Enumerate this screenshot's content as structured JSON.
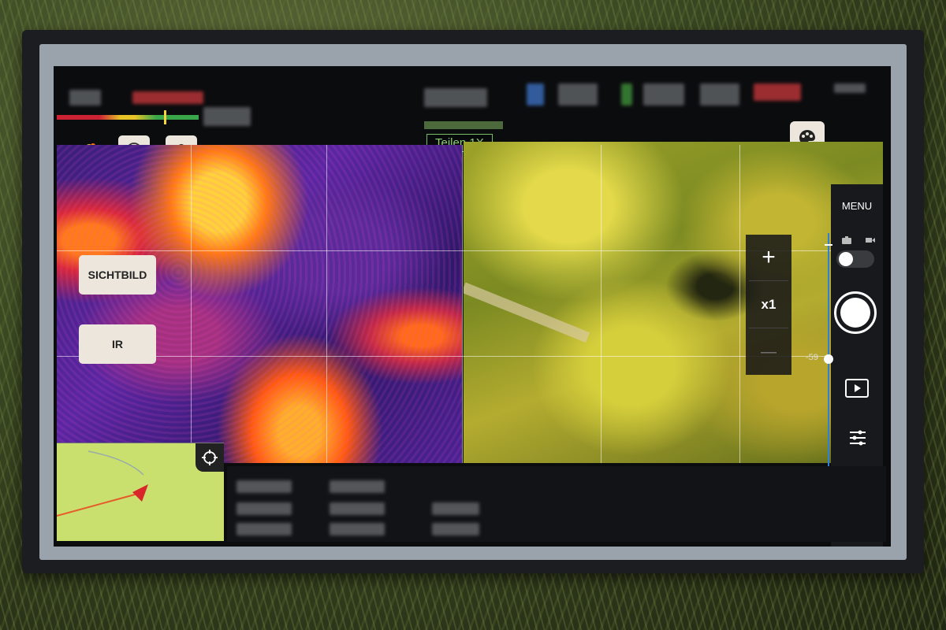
{
  "feeds": {
    "ir_button_label": "SICHTBILD",
    "ir_mode_label": "IR",
    "share_label": "Teilen 1X"
  },
  "zoom": {
    "plus_label": "+",
    "level_label": "x1",
    "minus_label": "—"
  },
  "camera_panel": {
    "menu_label": "MENU",
    "ev_value": "-59"
  },
  "icons": {
    "bell": "bell-icon",
    "compass": "compass-icon",
    "lightbulb": "lightbulb-icon",
    "palette": "palette-icon",
    "photo": "camera-icon",
    "video": "video-icon",
    "play": "play-icon",
    "settings": "settings-sliders-icon",
    "locate": "crosshair-locate-icon",
    "aircraft": "aircraft-arrow-icon"
  },
  "colors": {
    "accent_blue": "#2f7fd6",
    "share_green": "#8ed07a",
    "map_green": "#c9e06e",
    "aircraft_red": "#d8262a"
  }
}
